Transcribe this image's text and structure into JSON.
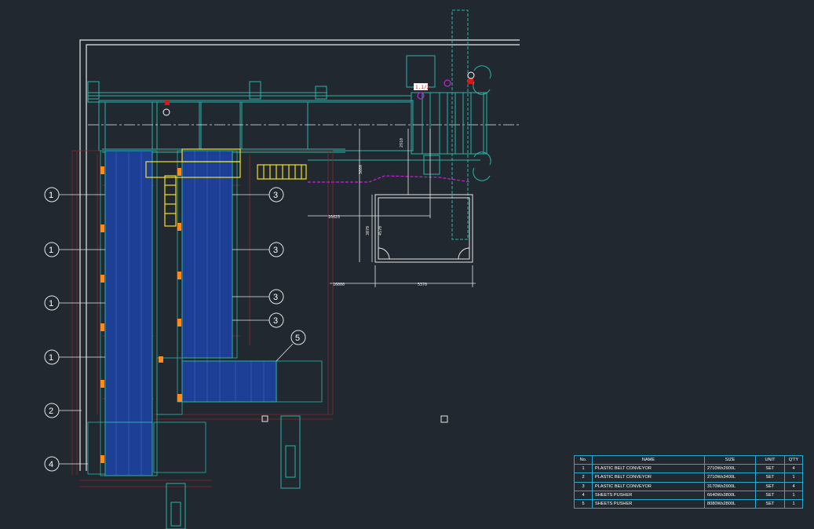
{
  "balloons": [
    {
      "label": "1",
      "side": "left"
    },
    {
      "label": "1",
      "side": "left"
    },
    {
      "label": "1",
      "side": "left"
    },
    {
      "label": "1",
      "side": "left"
    },
    {
      "label": "2",
      "side": "left"
    },
    {
      "label": "4",
      "side": "left"
    },
    {
      "label": "3",
      "side": "right"
    },
    {
      "label": "3",
      "side": "right"
    },
    {
      "label": "3",
      "side": "right"
    },
    {
      "label": "3",
      "side": "right"
    },
    {
      "label": "5",
      "side": "right"
    }
  ],
  "dimensions": {
    "d_10623": "10623",
    "d_16000": "16000",
    "d_5370": "5370",
    "d_3070": "3070",
    "d_4570": "4570",
    "d_3080": "3080",
    "d_2910": "2910"
  },
  "tags": {
    "tag_1": "1.1/2"
  },
  "bom": {
    "headers": [
      "No.",
      "NAME",
      "SIZE",
      "UNIT",
      "Q'TY"
    ],
    "rows": [
      [
        "1",
        "PLASTIC BELT CONVEYOR",
        "2710Wx2900L",
        "SET",
        "4"
      ],
      [
        "2",
        "PLASTIC BELT CONVEYOR",
        "2710Wx3400L",
        "SET",
        "1"
      ],
      [
        "3",
        "PLASTIC BELT CONVEYOR",
        "3170Wx2900L",
        "SET",
        "4"
      ],
      [
        "4",
        "SHEETS PUSHER",
        "6640Wx3800L",
        "SET",
        "1"
      ],
      [
        "5",
        "SHEETS PUSHER",
        "8080Wx2800L",
        "SET",
        "1"
      ]
    ]
  },
  "colors": {
    "background": "#212830",
    "frame": "#e6e6e6",
    "cyan": "#2bb3a8",
    "belt": "#1d3f95",
    "yellow": "#f4e12b",
    "orange": "#ff8a1f",
    "dimension": "#8a2a2a",
    "magenta": "#c026d3"
  }
}
